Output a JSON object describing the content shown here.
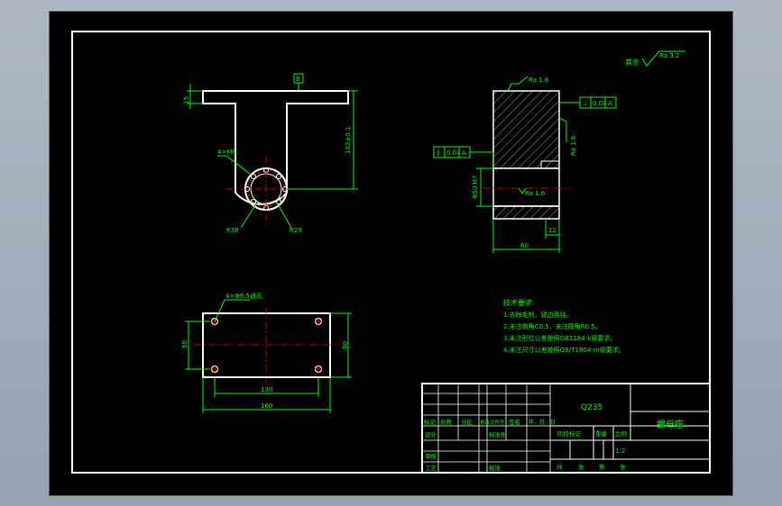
{
  "viewport": {
    "background": "#000000",
    "line_color": "#ffffff",
    "dim_color": "#00ff00",
    "center_color": "#ff0000",
    "sheet_color": "#ffffff"
  },
  "roughness_general": {
    "label": "其余",
    "value": "Ra 3.2"
  },
  "front_view": {
    "datum_label": "B",
    "dim_top_thickness": "15",
    "dim_height": "102±0.1",
    "dim_holes": "4×M6",
    "dim_radius_outer": "R38",
    "dim_radius_inner": "R29"
  },
  "side_view": {
    "roughness_top": "Ra 1.6",
    "roughness_right": "Ra 1.6",
    "roughness_bore": "Ra 1.6",
    "gdt_right": {
      "symbol": "⊥",
      "tolerance": "0.04",
      "datum": "A"
    },
    "gdt_left": {
      "symbol": "∥",
      "tolerance": "0.04",
      "datum": "A"
    },
    "dim_bore": "Φ50 H7",
    "dim_width": "60",
    "dim_step": "12"
  },
  "plan_view": {
    "hole_note": "4×Φ6.5通孔",
    "dim_left": "60",
    "dim_right": "80",
    "dim_inner": "130",
    "dim_total": "160"
  },
  "tech_requirements": {
    "title": "技术要求",
    "items": [
      "1.去除毛刺，锐边倒钝。",
      "2.未注倒角C0.5，未注圆角R0.5。",
      "3.未注形位公差按照GB1184-k级要求。",
      "4.未注尺寸公差按照GB/T1804-m级要求。"
    ]
  },
  "title_block": {
    "material": "Q235",
    "part_name": "螺母座",
    "row_header": [
      "标记",
      "处数",
      "分区",
      "更改文件号",
      "签名",
      "年、月、日"
    ],
    "design": "设计",
    "standardize": "标准化",
    "review": "审核",
    "process": "工艺",
    "approve": "批准",
    "stage_mark": "阶段标记",
    "weight": "重量",
    "scale_label": "比例",
    "scale_value": "1:2",
    "sheet_info": [
      "共",
      "张",
      "第",
      "张"
    ]
  }
}
